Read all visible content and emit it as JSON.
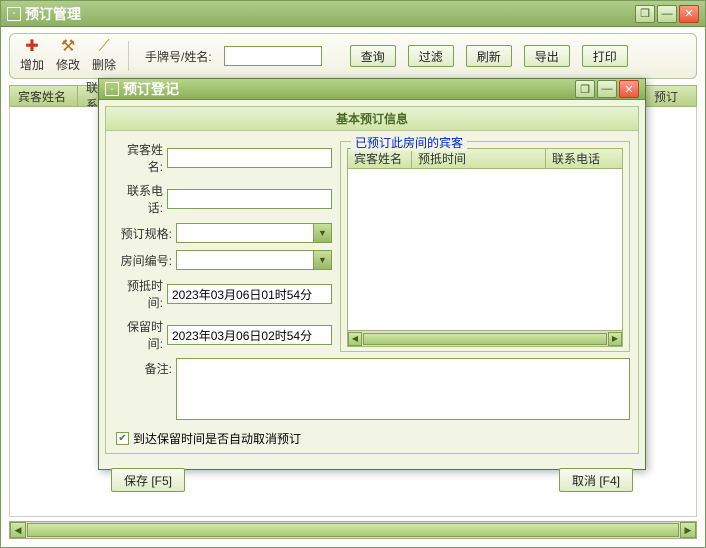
{
  "main": {
    "title": "预订管理",
    "toolbar": {
      "add": "增加",
      "edit": "修改",
      "delete": "删除",
      "search_label": "手牌号/姓名:",
      "query": "查询",
      "filter": "过滤",
      "refresh": "刷新",
      "export": "导出",
      "print": "打印"
    },
    "grid": {
      "col_guest": "宾客姓名",
      "col_contact": "联系",
      "col_reserve": "预订"
    }
  },
  "dialog": {
    "title": "预订登记",
    "section": "基本预订信息",
    "fields": {
      "guest_label": "宾客姓名:",
      "phone_label": "联系电话:",
      "spec_label": "预订规格:",
      "room_label": "房间编号:",
      "arrive_label": "预抵时间:",
      "arrive_value": "2023年03月06日01时54分",
      "hold_label": "保留时间:",
      "hold_value": "2023年03月06日02时54分",
      "remark_label": "备注:"
    },
    "existing": {
      "legend": "已预订此房间的宾客",
      "col_guest": "宾客姓名",
      "col_arrive": "预抵时间",
      "col_phone": "联系电话"
    },
    "checkbox_label": "到达保留时间是否自动取消预订",
    "save_btn": "保存 [F5]",
    "cancel_btn": "取消 [F4]"
  }
}
